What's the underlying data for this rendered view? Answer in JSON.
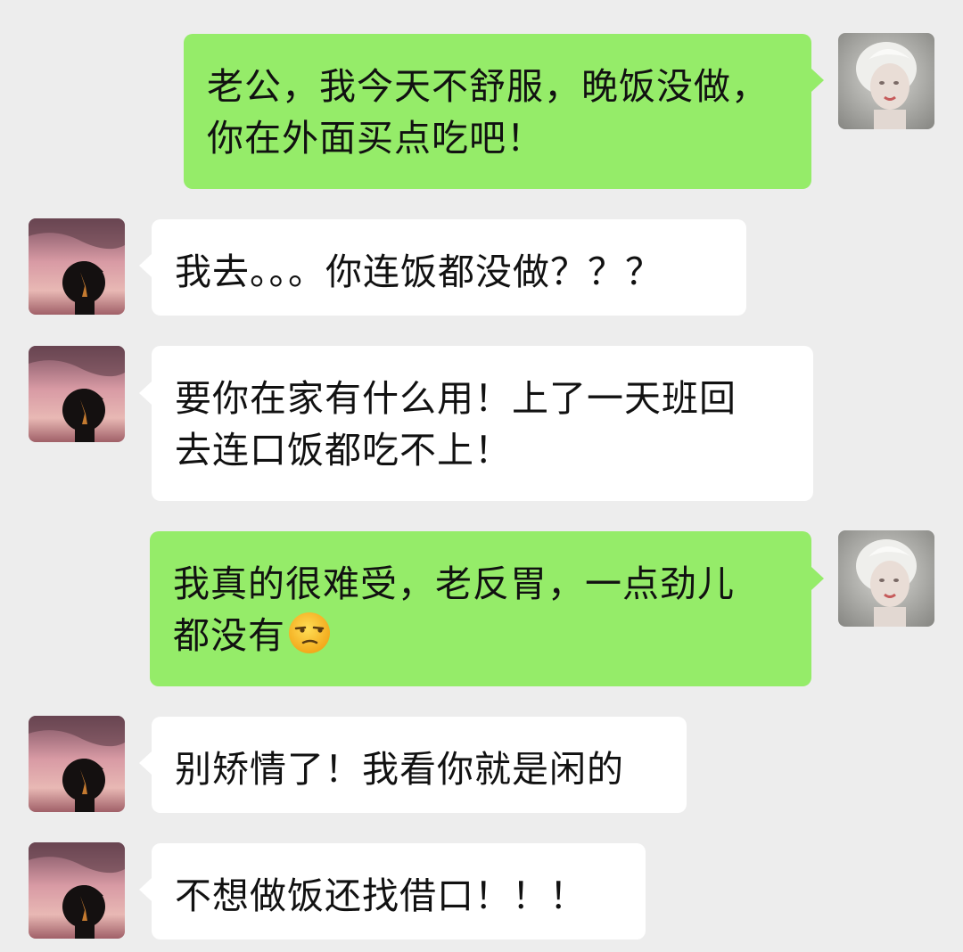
{
  "conversation": {
    "messages": [
      {
        "sender": "self",
        "lines": [
          "老公，我今天不舒服，晚饭没做，",
          "你在外面买点吃吧！"
        ],
        "emoji": null
      },
      {
        "sender": "other",
        "lines": [
          "我去。。。你连饭都没做？？？"
        ],
        "emoji": null
      },
      {
        "sender": "other",
        "lines": [
          "要你在家有什么用！上了一天班回",
          "去连口饭都吃不上！"
        ],
        "emoji": null
      },
      {
        "sender": "self",
        "lines": [
          "我真的很难受，老反胃，一点劲儿",
          "都没有"
        ],
        "emoji": "unamused-face"
      },
      {
        "sender": "other",
        "lines": [
          "别矫情了！我看你就是闲的"
        ],
        "emoji": null
      },
      {
        "sender": "other",
        "lines": [
          "不想做饭还找借口！！！"
        ],
        "emoji": null
      }
    ]
  },
  "colors": {
    "background": "#ededed",
    "self_bubble": "#95ec69",
    "other_bubble": "#ffffff",
    "text": "#111111"
  },
  "avatars": {
    "self": "girl-portrait-avatar",
    "other": "silhouette-sunset-avatar"
  }
}
